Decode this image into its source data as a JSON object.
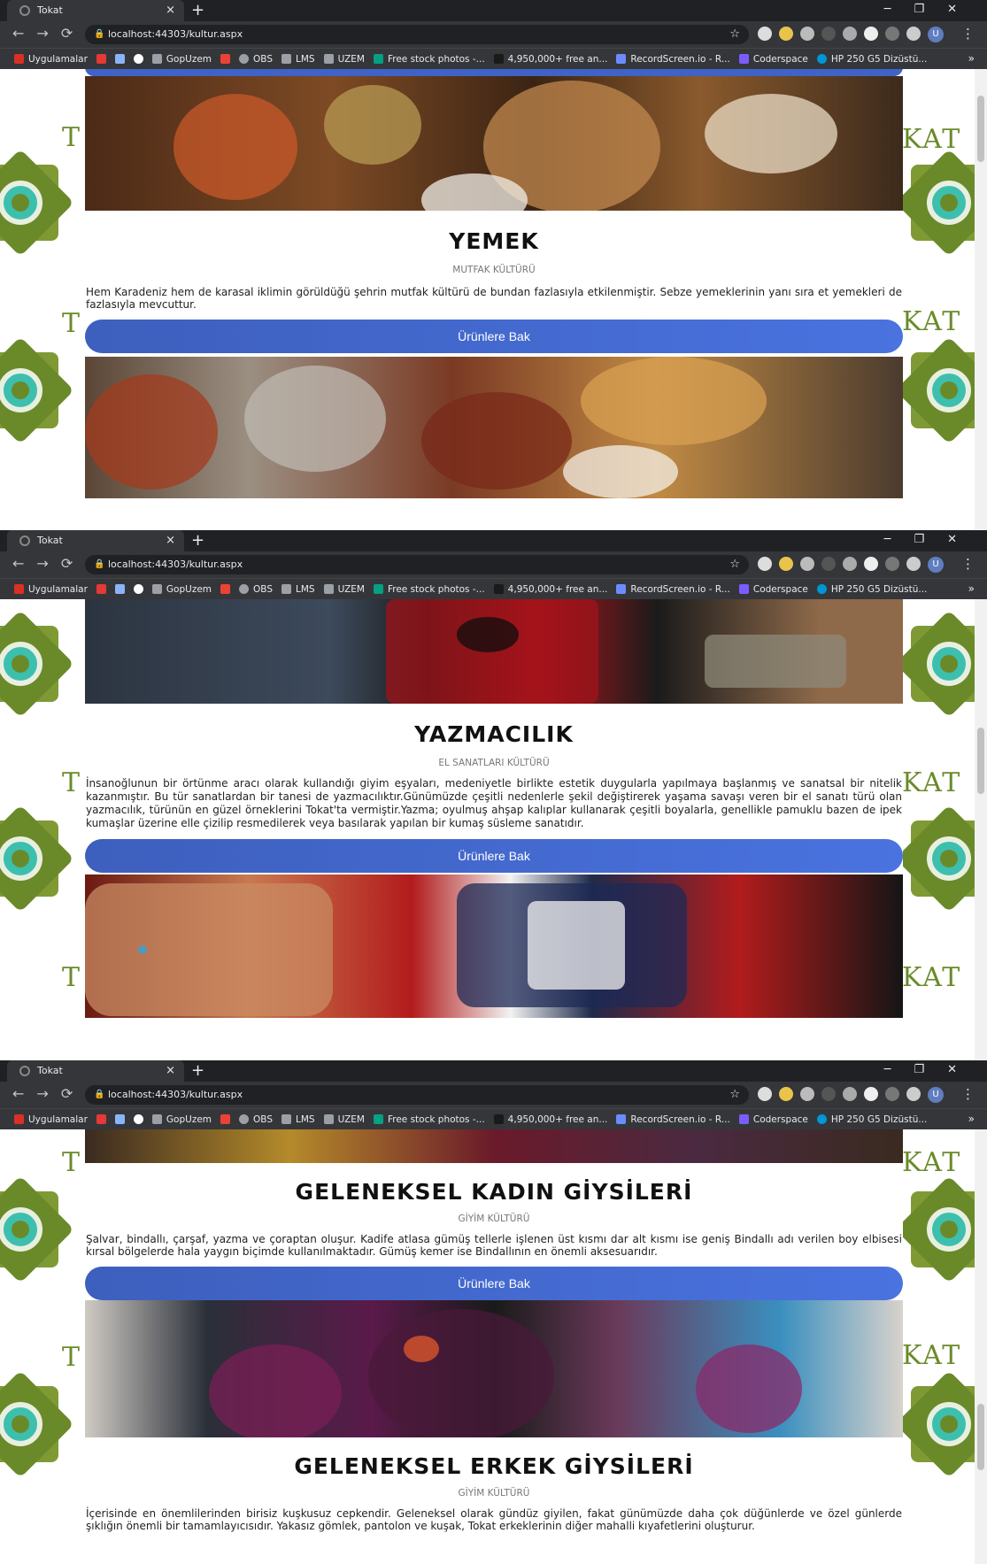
{
  "browser": {
    "tab_title": "Tokat",
    "tab_close": "×",
    "new_tab": "+",
    "url": "localhost:44303/kultur.aspx",
    "profile_initial": "U",
    "bookmarks": [
      "Uygulamalar",
      "",
      "",
      "",
      "GopUzem",
      "",
      "OBS",
      "LMS",
      "UZEM",
      "Free stock photos -...",
      "4,950,000+ free an...",
      "RecordScreen.io - R...",
      "Coderspace",
      "HP 250 G5 Dizüstü..."
    ],
    "more": "»"
  },
  "deco": {
    "kat": "KAT",
    "t": "T"
  },
  "sections": {
    "yemek": {
      "title": "YEMEK",
      "sub": "MUTFAK KÜLTÜRÜ",
      "desc": "Hem Karadeniz hem de karasal iklimin görüldüğü şehrin mutfak kültürü de bundan fazlasıyla etkilenmiştir. Sebze yemeklerinin yanı sıra et yemekleri de fazlasıyla mevcuttur.",
      "button": "Ürünlere Bak"
    },
    "yazmacilik": {
      "title": "YAZMACILIK",
      "sub": "EL SANATLARI KÜLTÜRÜ",
      "desc": "İnsanoğlunun bir örtünme aracı olarak kullandığı giyim eşyaları, medeniyetle birlikte estetik duygularla yapılmaya başlanmış ve sanatsal bir nitelik kazanmıştır. Bu tür sanatlardan bir tanesi de yazmacılıktır.Günümüzde çeşitli nedenlerle şekil değiştirerek yaşama savaşı veren bir el sanatı türü olan yazmacılık, türünün en güzel örneklerini Tokat'ta vermiştir.Yazma; oyulmuş ahşap kalıplar kullanarak çeşitli boyalarla, genellikle pamuklu bazen de ipek kumaşlar üzerine elle çizilip resmedilerek veya basılarak yapılan bir kumaş süsleme sanatıdır.",
      "button": "Ürünlere Bak"
    },
    "kadin": {
      "title": "GELENEKSEL KADIN GİYSİLERİ",
      "sub": "GİYİM KÜLTÜRÜ",
      "desc": "Şalvar, bindallı, çarşaf, yazma ve çoraptan oluşur. Kadife atlasa gümüş tellerle işlenen üst kısmı dar alt kısmı ise geniş Bindallı adı verilen boy elbisesi kırsal bölgelerde hala yaygın biçimde kullanılmaktadır. Gümüş kemer ise Bindallının en önemli aksesuarıdır.",
      "button": "Ürünlere Bak"
    },
    "erkek": {
      "title": "GELENEKSEL ERKEK GİYSİLERİ",
      "sub": "GİYİM KÜLTÜRÜ",
      "desc": "İçerisinde en önemlilerinden birisiz kuşkusuz cepkendir. Geleneksel olarak gündüz giyilen, fakat günümüzde daha çok düğünlerde ve özel günlerde şıklığın önemli bir tamamlayıcısıdır. Yakasız gömlek, pantolon ve kuşak, Tokat erkeklerinin diğer mahalli kıyafetlerini oluşturur."
    }
  },
  "colors": {
    "button": "#4a6fd6",
    "chrome_dark": "#202124",
    "chrome_mid": "#35363a",
    "deco_green": "#6a8a2a",
    "deco_teal": "#3dbfae"
  }
}
